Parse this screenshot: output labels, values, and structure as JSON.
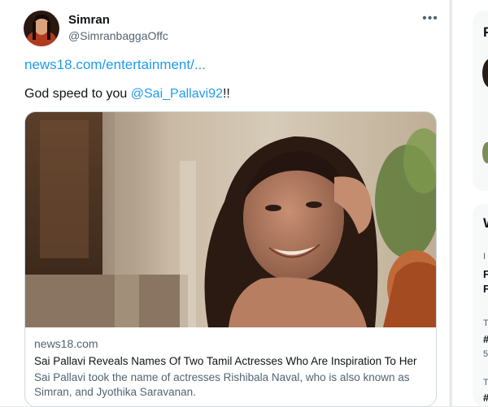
{
  "tweet": {
    "display_name": "Simran",
    "handle": "@SimranbaggaOffc",
    "more_icon": "more-horizontal-icon",
    "link": "news18.com/entertainment/...",
    "body_text": "God speed to you ",
    "mention": "@Sai_Pallavi92",
    "body_suffix": "!!",
    "card": {
      "domain": "news18.com",
      "title": "Sai Pallavi Reveals Names Of Two Tamil Actresses Who Are Inspiration To Her",
      "description": "Sai Pallavi took the name of actresses Rishibala Naval, who is also known as Simran, and Jyothika Saravanan."
    }
  },
  "right_sidebar": {
    "fragments": [
      "F",
      "W",
      "I",
      "F",
      "F",
      "T",
      "#",
      "5",
      "T",
      "#"
    ]
  },
  "colors": {
    "accent": "#1d9bf0",
    "text": "#0f1419",
    "secondary": "#536471",
    "border": "#cfd9de"
  }
}
